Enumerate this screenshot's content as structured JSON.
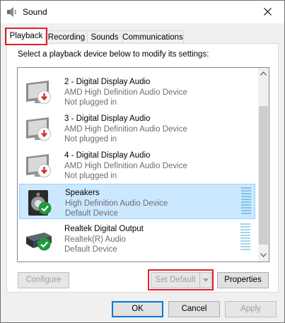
{
  "window": {
    "title": "Sound",
    "icon": "speaker-icon",
    "close_icon": "close-icon"
  },
  "tabs": [
    {
      "label": "Playback",
      "active": true
    },
    {
      "label": "Recording",
      "active": false
    },
    {
      "label": "Sounds",
      "active": false
    },
    {
      "label": "Communications",
      "active": false
    }
  ],
  "playback": {
    "instruction": "Select a playback device below to modify its settings:",
    "devices": [
      {
        "name": "2 - Digital Display Audio",
        "driver": "AMD High Definition Audio Device",
        "status": "Not plugged in",
        "icon": "monitor-icon",
        "badge": "unplugged-icon",
        "selected": false
      },
      {
        "name": "3 - Digital Display Audio",
        "driver": "AMD High Definition Audio Device",
        "status": "Not plugged in",
        "icon": "monitor-icon",
        "badge": "unplugged-icon",
        "selected": false
      },
      {
        "name": "4 - Digital Display Audio",
        "driver": "AMD High Definition Audio Device",
        "status": "Not plugged in",
        "icon": "monitor-icon",
        "badge": "unplugged-icon",
        "selected": false
      },
      {
        "name": "Speakers",
        "driver": "High Definition Audio Device",
        "status": "Default Device",
        "icon": "speaker-icon",
        "badge": "default-check-icon",
        "selected": true
      },
      {
        "name": "Realtek Digital Output",
        "driver": "Realtek(R) Audio",
        "status": "Default Device",
        "icon": "digital-output-icon",
        "badge": "default-check-icon",
        "selected": false
      }
    ]
  },
  "buttons": {
    "configure": "Configure",
    "set_default": "Set Default",
    "properties": "Properties",
    "ok": "OK",
    "cancel": "Cancel",
    "apply": "Apply"
  },
  "colors": {
    "highlight": "#e0202a",
    "selection": "#cce8ff",
    "accent": "#0078d7",
    "unplugged": "#d32f2f",
    "default_check": "#1e9b3a"
  }
}
